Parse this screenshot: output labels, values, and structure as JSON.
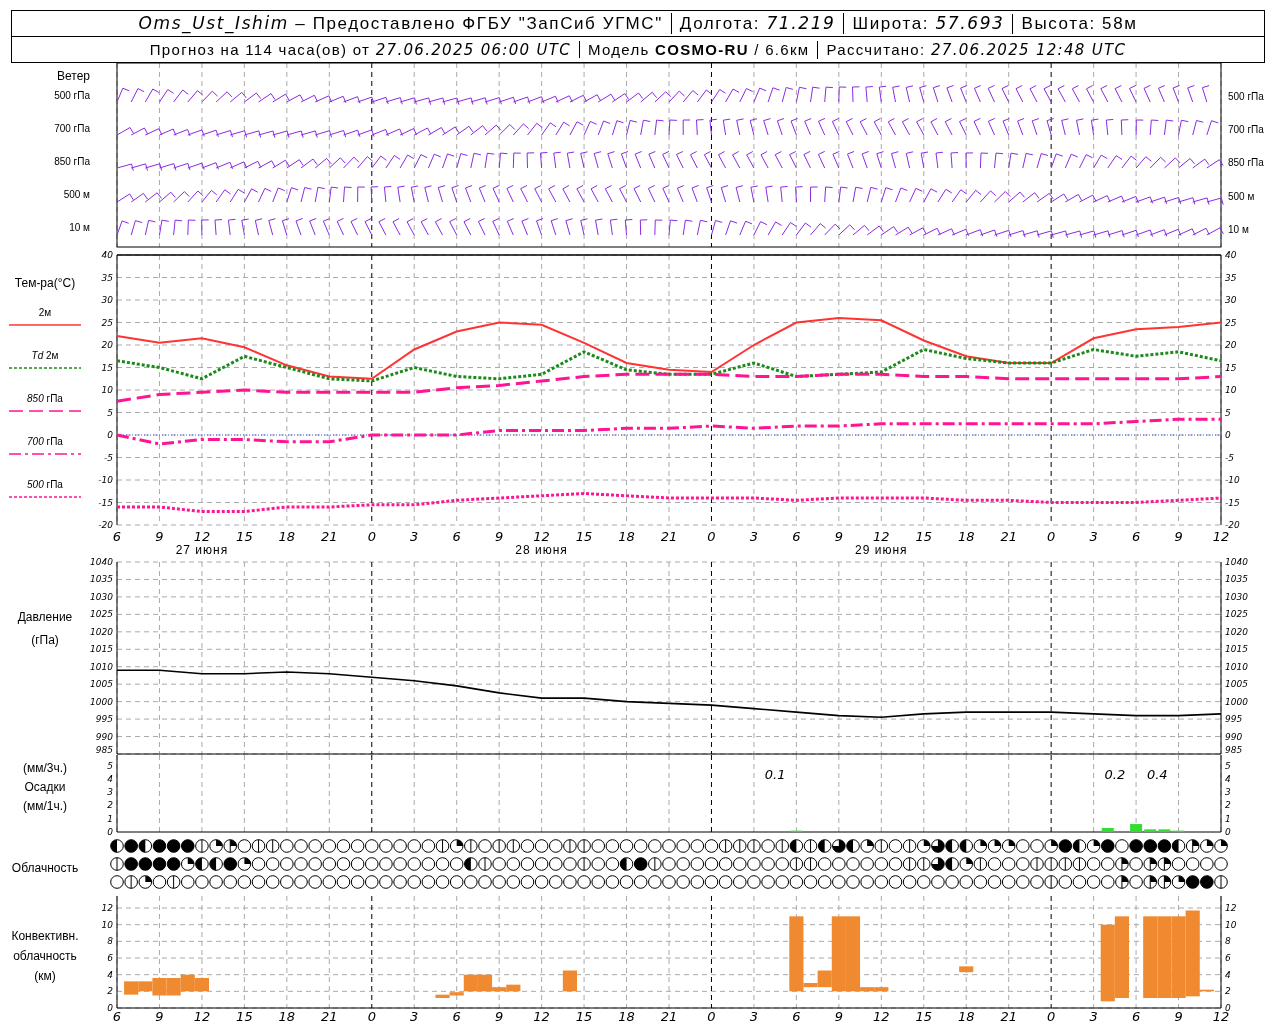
{
  "header": {
    "rows": [
      [
        "*Oms_Ust_Ishim* – Предоставлено ФГБУ \"ЗапСиб УГМС\"",
        "Долгота: *71.219*",
        "Широта: *57.693*",
        "Высота: 58м"
      ],
      [
        "Прогноз на 114 часа(ов) от *27.06.2025 06:00 UTC*",
        "Модель **COSMO-RU** / 6.6км",
        "Рассчитано: *27.06.2025 12:48 UTC*"
      ]
    ]
  },
  "wind": {
    "title": "Ветер",
    "labels_left": [
      "500 гПа",
      "700 гПа",
      "850 гПа",
      "500 м",
      "10 м"
    ],
    "labels_right": [
      "500 гПа",
      "700 гПа",
      "850 гПа",
      "500 м",
      "10 м"
    ]
  },
  "temperature": {
    "label": "Тем-ра(°C)",
    "right_ticks": [
      "40",
      "35",
      "30",
      "25",
      "20",
      "15",
      "10",
      "5",
      "0",
      "-5",
      "-10",
      "-15",
      "-20"
    ],
    "chart_data": {
      "type": "line",
      "categories": [
        "6",
        "9",
        "12",
        "15",
        "18",
        "21",
        "0",
        "3",
        "6",
        "9",
        "12",
        "15",
        "18",
        "21",
        "0",
        "3",
        "6",
        "9",
        "12",
        "15",
        "18",
        "21",
        "0",
        "3",
        "6",
        "9",
        "12"
      ],
      "series": [
        {
          "name": "2м",
          "color": "#ff3333",
          "line_style": "solid",
          "values": [
            22,
            20.5,
            21.5,
            19.5,
            15.5,
            13,
            12.5,
            19,
            23,
            25,
            24.5,
            20.5,
            16,
            14.5,
            14,
            20,
            25,
            26,
            25.5,
            21,
            17.5,
            16,
            16,
            21.5,
            23.5,
            24,
            25
          ]
        },
        {
          "name": "*Td* 2м",
          "color": "#1a8a1a",
          "line_style": "dotted",
          "values": [
            16.5,
            15,
            12.5,
            17.5,
            15,
            12.5,
            12,
            15,
            13,
            12.5,
            13.5,
            18.5,
            14.5,
            13.5,
            13.5,
            16,
            13,
            13.5,
            14,
            19,
            17,
            16,
            16,
            19,
            17.5,
            18.5,
            16.5
          ]
        },
        {
          "name": "*850* гПа",
          "color": "#ff1493",
          "line_style": "dashed",
          "values": [
            7.5,
            9,
            9.5,
            10,
            9.5,
            9.5,
            9.5,
            9.5,
            10.5,
            11,
            12,
            13,
            13.5,
            13.5,
            13.5,
            13,
            13,
            13.5,
            13.5,
            13,
            13,
            12.5,
            12.5,
            12.5,
            12.5,
            12.5,
            13
          ]
        },
        {
          "name": "*700* гПа",
          "color": "#ff1493",
          "line_style": "dashdot",
          "values": [
            0,
            -2,
            -1,
            -1,
            -1.5,
            -1.5,
            0,
            0,
            0,
            1,
            1,
            1,
            1.5,
            1.5,
            2,
            1.5,
            2,
            2,
            2.5,
            2.5,
            2.5,
            2.5,
            2.5,
            2.5,
            3,
            3.5,
            3.5
          ]
        },
        {
          "name": "*500* гПа",
          "color": "#ff1493",
          "line_style": "dotted",
          "values": [
            -16,
            -16,
            -17,
            -17,
            -16,
            -16,
            -15.5,
            -15.5,
            -14.5,
            -14,
            -13.5,
            -13,
            -13.5,
            -14,
            -14,
            -14,
            -14.5,
            -14,
            -14,
            -14,
            -14.5,
            -14.5,
            -15,
            -15,
            -15,
            -14.5,
            -14
          ]
        }
      ],
      "ylim": [
        -20,
        40
      ],
      "yticks": [
        -20,
        -15,
        -10,
        -5,
        0,
        5,
        10,
        15,
        20,
        25,
        30,
        35,
        40
      ],
      "grid": true,
      "ref_lines": [
        {
          "axis": "y",
          "value": 0,
          "color": "#3355ff",
          "line_style": "dotted"
        }
      ],
      "annotations": [
        "27 июня",
        "28 июня",
        "29 июня"
      ]
    }
  },
  "pressure": {
    "right_ticks": [
      "1040",
      "1035",
      "1030",
      "1025",
      "1020",
      "1015",
      "1010",
      "1005",
      "1000",
      "995",
      "990",
      "985"
    ],
    "chart_data": {
      "type": "line",
      "ylabel": "Давление (гПа)",
      "grid": true,
      "values": [
        1009,
        1009,
        1008,
        1008,
        1008.5,
        1008,
        1007,
        1006,
        1004.5,
        1002.5,
        1001,
        1001,
        1000,
        999.5,
        999,
        998,
        997,
        996,
        995.5,
        996.5,
        997,
        997,
        997,
        996.5,
        996,
        996,
        996.5
      ],
      "ylim": [
        985,
        1040
      ],
      "yticks": [
        985,
        990,
        995,
        1000,
        1005,
        1010,
        1015,
        1020,
        1025,
        1030,
        1035,
        1040
      ]
    }
  },
  "precipitation": {
    "unit_top": "(мм/3ч.)",
    "unit_bottom": "(мм/1ч.)",
    "right_ticks": [
      "5",
      "4",
      "3",
      "2",
      "1",
      "0"
    ],
    "chart_data": {
      "type": "bar",
      "ylabel": "Осадки",
      "grid": true,
      "series": [
        {
          "color": "#33dd33",
          "values": [
            null,
            null,
            null,
            null,
            null,
            null,
            null,
            null,
            null,
            null,
            null,
            null,
            null,
            null,
            null,
            null,
            null,
            null,
            null,
            null,
            null,
            null,
            null,
            null,
            null,
            null,
            null,
            null,
            null,
            null,
            null,
            null,
            null,
            null,
            null,
            null,
            null,
            null,
            null,
            null,
            null,
            null,
            null,
            null,
            null,
            null,
            null,
            null,
            0.1,
            null,
            null,
            null,
            null,
            null,
            null,
            null,
            null,
            null,
            null,
            null,
            null,
            null,
            null,
            null,
            null,
            null,
            null,
            null,
            null,
            null,
            0.3,
            null,
            0.6,
            0.2,
            0.2,
            0.1,
            null,
            null,
            null
          ]
        }
      ],
      "ylim": [
        0,
        5.8
      ],
      "yticks": [
        0,
        1,
        2,
        3,
        4,
        5
      ],
      "annotations": [
        "0.1",
        "0.2",
        "0.4"
      ]
    }
  },
  "cloudiness": {
    "label": "Облачность",
    "rows": [
      {
        "cells": [
          {
            "kind": "half"
          },
          {
            "kind": "full"
          },
          {
            "kind": "half"
          },
          {
            "kind": "full"
          },
          {
            "kind": "full"
          },
          {
            "kind": "full"
          },
          {
            "kind": "line"
          },
          {
            "kind": "quarter"
          },
          {
            "kind": "mixed"
          },
          {
            "kind": "clear"
          },
          {
            "kind": "line"
          },
          {
            "kind": "line"
          },
          {
            "kind": "clear"
          },
          {
            "kind": "clear"
          },
          {
            "kind": "clear"
          },
          {
            "kind": "clear"
          },
          {
            "kind": "clear"
          },
          {
            "kind": "clear"
          },
          {
            "kind": "clear"
          },
          {
            "kind": "clear"
          },
          {
            "kind": "clear"
          },
          {
            "kind": "clear"
          },
          {
            "kind": "clear"
          },
          {
            "kind": "line"
          },
          {
            "kind": "quarter"
          },
          {
            "kind": "line"
          },
          {
            "kind": "clear"
          },
          {
            "kind": "line"
          },
          {
            "kind": "line"
          },
          {
            "kind": "clear"
          },
          {
            "kind": "clear"
          },
          {
            "kind": "clear"
          },
          {
            "kind": "line"
          },
          {
            "kind": "line"
          },
          {
            "kind": "clear"
          },
          {
            "kind": "clear"
          },
          {
            "kind": "clear"
          },
          {
            "kind": "clear"
          },
          {
            "kind": "clear"
          },
          {
            "kind": "clear"
          },
          {
            "kind": "clear"
          },
          {
            "kind": "clear"
          },
          {
            "kind": "clear"
          },
          {
            "kind": "line"
          },
          {
            "kind": "line"
          },
          {
            "kind": "line"
          },
          {
            "kind": "clear"
          },
          {
            "kind": "line"
          },
          {
            "kind": "half"
          },
          {
            "kind": "line"
          },
          {
            "kind": "half"
          },
          {
            "kind": "most"
          },
          {
            "kind": "half"
          },
          {
            "kind": "quarter"
          },
          {
            "kind": "line"
          },
          {
            "kind": "clear"
          },
          {
            "kind": "line"
          },
          {
            "kind": "quarter"
          },
          {
            "kind": "most"
          },
          {
            "kind": "half"
          },
          {
            "kind": "half"
          },
          {
            "kind": "quarter"
          },
          {
            "kind": "quarter"
          },
          {
            "kind": "quarter"
          },
          {
            "kind": "clear"
          },
          {
            "kind": "clear"
          },
          {
            "kind": "quarter"
          },
          {
            "kind": "full"
          },
          {
            "kind": "half"
          },
          {
            "kind": "quarter"
          },
          {
            "kind": "full"
          },
          {
            "kind": "clear"
          },
          {
            "kind": "full"
          },
          {
            "kind": "full"
          },
          {
            "kind": "full"
          },
          {
            "kind": "half"
          },
          {
            "kind": "mixed"
          },
          {
            "kind": "quarter"
          },
          {
            "kind": "quarter"
          }
        ]
      },
      {
        "cells": [
          {
            "kind": "line"
          },
          {
            "kind": "full"
          },
          {
            "kind": "full"
          },
          {
            "kind": "full"
          },
          {
            "kind": "full"
          },
          {
            "kind": "quarter"
          },
          {
            "kind": "half"
          },
          {
            "kind": "half"
          },
          {
            "kind": "full"
          },
          {
            "kind": "quarter"
          },
          {
            "kind": "clear"
          },
          {
            "kind": "clear"
          },
          {
            "kind": "clear"
          },
          {
            "kind": "clear"
          },
          {
            "kind": "clear"
          },
          {
            "kind": "clear"
          },
          {
            "kind": "clear"
          },
          {
            "kind": "clear"
          },
          {
            "kind": "clear"
          },
          {
            "kind": "clear"
          },
          {
            "kind": "clear"
          },
          {
            "kind": "clear"
          },
          {
            "kind": "clear"
          },
          {
            "kind": "clear"
          },
          {
            "kind": "clear"
          },
          {
            "kind": "half"
          },
          {
            "kind": "line"
          },
          {
            "kind": "clear"
          },
          {
            "kind": "clear"
          },
          {
            "kind": "clear"
          },
          {
            "kind": "clear"
          },
          {
            "kind": "clear"
          },
          {
            "kind": "clear"
          },
          {
            "kind": "line"
          },
          {
            "kind": "clear"
          },
          {
            "kind": "clear"
          },
          {
            "kind": "half"
          },
          {
            "kind": "full"
          },
          {
            "kind": "line"
          },
          {
            "kind": "clear"
          },
          {
            "kind": "clear"
          },
          {
            "kind": "clear"
          },
          {
            "kind": "clear"
          },
          {
            "kind": "clear"
          },
          {
            "kind": "clear"
          },
          {
            "kind": "clear"
          },
          {
            "kind": "clear"
          },
          {
            "kind": "clear"
          },
          {
            "kind": "line"
          },
          {
            "kind": "line"
          },
          {
            "kind": "clear"
          },
          {
            "kind": "clear"
          },
          {
            "kind": "clear"
          },
          {
            "kind": "clear"
          },
          {
            "kind": "clear"
          },
          {
            "kind": "clear"
          },
          {
            "kind": "line"
          },
          {
            "kind": "line"
          },
          {
            "kind": "most"
          },
          {
            "kind": "half"
          },
          {
            "kind": "quarter"
          },
          {
            "kind": "line"
          },
          {
            "kind": "clear"
          },
          {
            "kind": "clear"
          },
          {
            "kind": "clear"
          },
          {
            "kind": "line"
          },
          {
            "kind": "line"
          },
          {
            "kind": "line"
          },
          {
            "kind": "line"
          },
          {
            "kind": "clear"
          },
          {
            "kind": "clear"
          },
          {
            "kind": "mixed"
          },
          {
            "kind": "clear"
          },
          {
            "kind": "mixed"
          },
          {
            "kind": "mixed"
          },
          {
            "kind": "clear"
          },
          {
            "kind": "clear"
          },
          {
            "kind": "clear"
          },
          {
            "kind": "clear"
          }
        ]
      },
      {
        "cells": [
          {
            "kind": "clear"
          },
          {
            "kind": "line"
          },
          {
            "kind": "quarter"
          },
          {
            "kind": "clear"
          },
          {
            "kind": "line"
          },
          {
            "kind": "clear"
          },
          {
            "kind": "clear"
          },
          {
            "kind": "clear"
          },
          {
            "kind": "clear"
          },
          {
            "kind": "clear"
          },
          {
            "kind": "clear"
          },
          {
            "kind": "clear"
          },
          {
            "kind": "clear"
          },
          {
            "kind": "clear"
          },
          {
            "kind": "clear"
          },
          {
            "kind": "clear"
          },
          {
            "kind": "clear"
          },
          {
            "kind": "clear"
          },
          {
            "kind": "clear"
          },
          {
            "kind": "clear"
          },
          {
            "kind": "clear"
          },
          {
            "kind": "clear"
          },
          {
            "kind": "clear"
          },
          {
            "kind": "clear"
          },
          {
            "kind": "clear"
          },
          {
            "kind": "clear"
          },
          {
            "kind": "clear"
          },
          {
            "kind": "clear"
          },
          {
            "kind": "clear"
          },
          {
            "kind": "clear"
          },
          {
            "kind": "clear"
          },
          {
            "kind": "clear"
          },
          {
            "kind": "clear"
          },
          {
            "kind": "clear"
          },
          {
            "kind": "clear"
          },
          {
            "kind": "clear"
          },
          {
            "kind": "clear"
          },
          {
            "kind": "clear"
          },
          {
            "kind": "clear"
          },
          {
            "kind": "clear"
          },
          {
            "kind": "clear"
          },
          {
            "kind": "clear"
          },
          {
            "kind": "clear"
          },
          {
            "kind": "clear"
          },
          {
            "kind": "clear"
          },
          {
            "kind": "clear"
          },
          {
            "kind": "clear"
          },
          {
            "kind": "clear"
          },
          {
            "kind": "clear"
          },
          {
            "kind": "clear"
          },
          {
            "kind": "clear"
          },
          {
            "kind": "clear"
          },
          {
            "kind": "clear"
          },
          {
            "kind": "clear"
          },
          {
            "kind": "clear"
          },
          {
            "kind": "clear"
          },
          {
            "kind": "clear"
          },
          {
            "kind": "clear"
          },
          {
            "kind": "clear"
          },
          {
            "kind": "clear"
          },
          {
            "kind": "clear"
          },
          {
            "kind": "clear"
          },
          {
            "kind": "clear"
          },
          {
            "kind": "clear"
          },
          {
            "kind": "clear"
          },
          {
            "kind": "clear"
          },
          {
            "kind": "line"
          },
          {
            "kind": "clear"
          },
          {
            "kind": "clear"
          },
          {
            "kind": "clear"
          },
          {
            "kind": "clear"
          },
          {
            "kind": "mixed"
          },
          {
            "kind": "clear"
          },
          {
            "kind": "mixed"
          },
          {
            "kind": "mixed"
          },
          {
            "kind": "quarter"
          },
          {
            "kind": "full"
          },
          {
            "kind": "full"
          },
          {
            "kind": "line"
          }
        ]
      }
    ]
  },
  "convective": {
    "labels": [
      "Конвективн.",
      "облачность",
      "(км)"
    ],
    "right_ticks": [
      "12",
      "10",
      "8",
      "6",
      "4",
      "2",
      "0"
    ],
    "chart_data": {
      "type": "candlestick",
      "grid": true,
      "categories": [
        "6",
        null,
        null,
        "9",
        null,
        null,
        "12",
        null,
        null,
        "15",
        null,
        null,
        "18",
        null,
        null,
        "21",
        null,
        null,
        "0",
        null,
        null,
        "3",
        null,
        null,
        "6",
        null,
        null,
        "9",
        null,
        null,
        "12",
        null,
        null,
        "15",
        null,
        null,
        "18",
        null,
        null,
        "21",
        null,
        null,
        "0",
        null,
        null,
        "3",
        null,
        null,
        "6",
        null,
        null,
        "9",
        null,
        null,
        "12",
        null,
        null,
        "15",
        null,
        null,
        "18",
        null,
        null,
        "21",
        null,
        null,
        "0",
        null,
        null,
        "3",
        null,
        null,
        "6",
        null,
        null,
        "9",
        null,
        null,
        "12"
      ],
      "series": [
        {
          "color": "#f08a30",
          "ohlc": [
            null,
            [
              1.6,
              3.2,
              1.6,
              3.2
            ],
            [
              2,
              3.2,
              2,
              3.2
            ],
            [
              1.5,
              3.6,
              1.5,
              3.6
            ],
            [
              1.5,
              3.6,
              1.5,
              3.6
            ],
            [
              2,
              4,
              2,
              4
            ],
            [
              2,
              3.6,
              2,
              3.6
            ],
            null,
            null,
            null,
            null,
            null,
            null,
            null,
            null,
            null,
            null,
            null,
            null,
            null,
            null,
            null,
            null,
            [
              1.2,
              1.6,
              1.2,
              1.6
            ],
            [
              1.5,
              1.9,
              1.5,
              1.9
            ],
            [
              2,
              4,
              2,
              4
            ],
            [
              2,
              4,
              2,
              4
            ],
            [
              2,
              2.5,
              2,
              2.5
            ],
            [
              2,
              2.8,
              2,
              2.8
            ],
            null,
            null,
            null,
            [
              2,
              4.5,
              2,
              4.5
            ],
            null,
            null,
            null,
            null,
            null,
            null,
            null,
            null,
            null,
            null,
            null,
            null,
            null,
            null,
            null,
            [
              2,
              11,
              2,
              11
            ],
            [
              2.5,
              3,
              2.5,
              3
            ],
            [
              2.5,
              4.5,
              2.5,
              4.5
            ],
            [
              2,
              11,
              2,
              11
            ],
            [
              2,
              11,
              2,
              11
            ],
            [
              2,
              2.5,
              2,
              2.5
            ],
            [
              2,
              2.5,
              2,
              2.5
            ],
            null,
            null,
            null,
            null,
            null,
            [
              4.3,
              5,
              4.3,
              5
            ],
            null,
            null,
            null,
            null,
            null,
            null,
            null,
            null,
            null,
            [
              0.8,
              10,
              0.8,
              10
            ],
            [
              1.2,
              11,
              1.2,
              11
            ],
            null,
            [
              1.2,
              11,
              1.2,
              11
            ],
            [
              1.2,
              11,
              1.2,
              11
            ],
            [
              1.2,
              11,
              1.2,
              11
            ],
            [
              1.4,
              11.7,
              1.4,
              11.7
            ],
            [
              2,
              2.2,
              2,
              2.2
            ],
            null
          ]
        }
      ],
      "ylim": [
        0,
        12
      ],
      "yticks": [
        0,
        2,
        4,
        6,
        8,
        10,
        12
      ]
    }
  }
}
